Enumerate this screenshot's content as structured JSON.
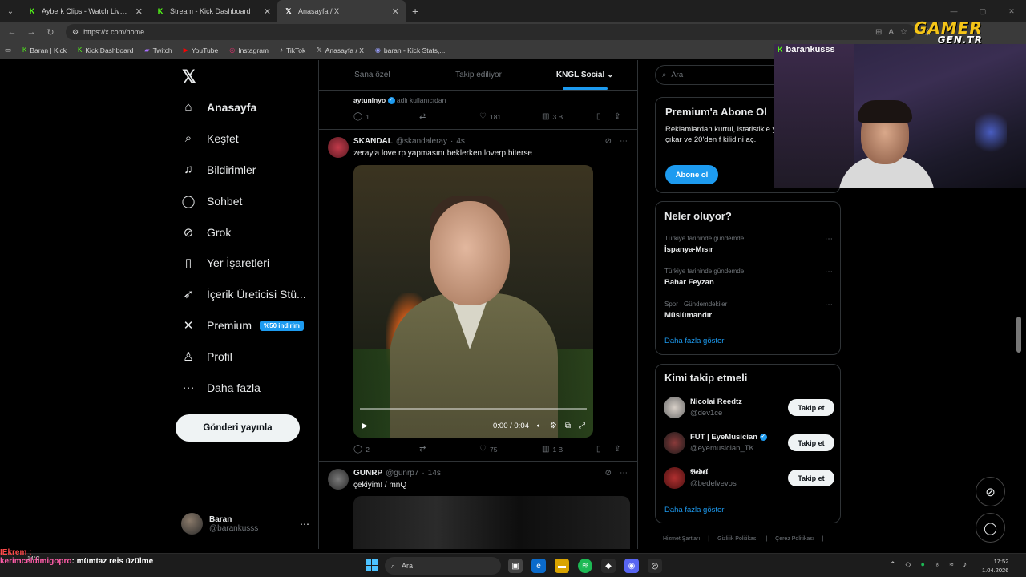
{
  "browser": {
    "tabs": [
      {
        "title": "Ayberk Clips - Watch Live on Kick",
        "favicon": "K"
      },
      {
        "title": "Stream - Kick Dashboard",
        "favicon": "K"
      },
      {
        "title": "Anasayfa / X",
        "favicon": "X"
      }
    ],
    "url": "https://x.com/home",
    "bookmarks": [
      "Baran | Kick",
      "Kick Dashboard",
      "Twitch",
      "YouTube",
      "Instagram",
      "TikTok",
      "Anasayfa / X",
      "baran - Kick Stats,..."
    ]
  },
  "sidebar": {
    "items": [
      {
        "label": "Anasayfa",
        "icon": "home-icon"
      },
      {
        "label": "Keşfet",
        "icon": "search-icon"
      },
      {
        "label": "Bildirimler",
        "icon": "bell-icon"
      },
      {
        "label": "Sohbet",
        "icon": "chat-icon"
      },
      {
        "label": "Grok",
        "icon": "grok-icon"
      },
      {
        "label": "Yer İşaretleri",
        "icon": "bookmark-icon"
      },
      {
        "label": "İçerik Üreticisi Stü...",
        "icon": "rocket-icon"
      },
      {
        "label": "Premium",
        "icon": "x-icon"
      },
      {
        "label": "Profil",
        "icon": "person-icon"
      },
      {
        "label": "Daha fazla",
        "icon": "more-icon"
      }
    ],
    "premium_badge": "%50 indirim",
    "post_button": "Gönderi yayınla",
    "profile": {
      "name": "Baran",
      "handle": "@barankusss"
    }
  },
  "feed": {
    "tabs": [
      "Sana özel",
      "Takip ediliyor",
      "KNGL Social"
    ],
    "prev_tweet": {
      "reply_user": "aytuninyo",
      "reply_suffix": "adlı kullanıcıdan",
      "replies": "1",
      "likes": "181",
      "views": "3 B"
    },
    "tweet1": {
      "username": "SKANDAL",
      "handle": "@skandaleray",
      "time": "4s",
      "text": "zerayla love rp yapmasını beklerken loverp biterse",
      "video_time": "0:00 / 0:04",
      "replies": "2",
      "likes": "75",
      "views": "1 B"
    },
    "tweet2": {
      "username": "GUNRP",
      "handle": "@gunrp7",
      "time": "14s",
      "text": "çekiyim! / mnQ"
    }
  },
  "right": {
    "search_placeholder": "Ara",
    "premium": {
      "title": "Premium'a Abone Ol",
      "text": "Reklamlardan kurtul, istatistikle yanıtlarını öne çıkar ve 20'den f kilidini aç.",
      "button": "Abone ol"
    },
    "trends": {
      "title": "Neler oluyor?",
      "items": [
        {
          "context": "Türkiye tarihinde gündemde",
          "topic": "İspanya-Mısır"
        },
        {
          "context": "Türkiye tarihinde gündemde",
          "topic": "Bahar Feyzan"
        },
        {
          "context": "Spor · Gündemdekiler",
          "topic": "Müslümandır"
        }
      ],
      "more": "Daha fazla göster"
    },
    "who_to_follow": {
      "title": "Kimi takip etmeli",
      "items": [
        {
          "name": "Nicolai Reedtz",
          "handle": "@dev1ce"
        },
        {
          "name": "FUT | EyeMusician",
          "handle": "@eyemusician_TK"
        },
        {
          "name": "𝕭𝖊𝖉𝖊𝖑",
          "handle": "@bedelvevos"
        }
      ],
      "follow_label": "Takip et",
      "more": "Daha fazla göster"
    },
    "footer": [
      "Hizmet Şartları",
      "Gizlilik Politikası",
      "Çerez Politikası"
    ]
  },
  "stream": {
    "cam_name": "barankusss",
    "logo_main": "GAMER",
    "logo_sub": "GEN.TR",
    "chat_line1_user": "IEkrem :",
    "chat_line2_user": "kerimceldimigopro",
    "chat_line2_text": ": mümtaz reis üzülme"
  },
  "taskbar": {
    "weather": "14°C",
    "search": "Ara",
    "time": "17:52",
    "date": "1.04.2026"
  }
}
